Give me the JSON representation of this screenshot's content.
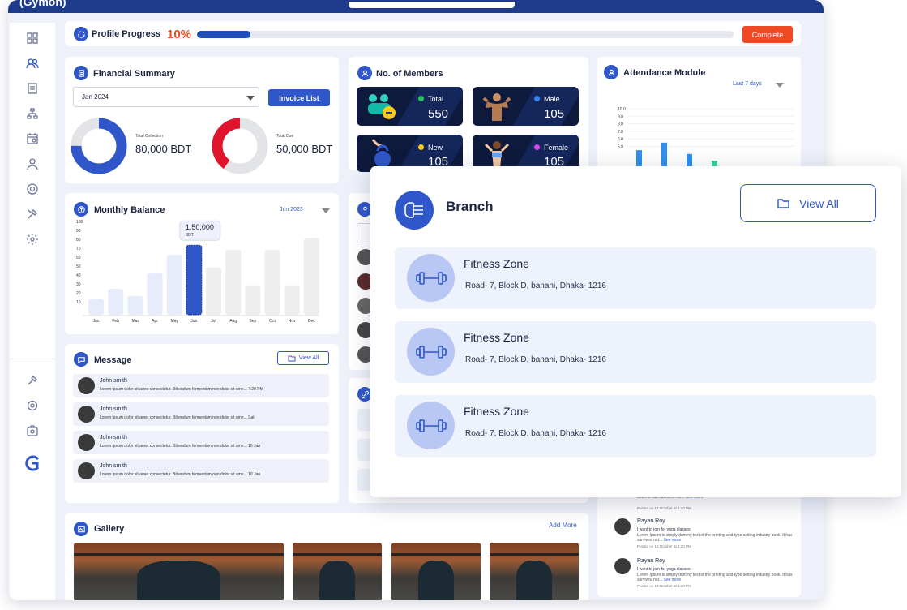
{
  "app": {
    "logo_text": "(Gymon)"
  },
  "profile_progress": {
    "title": "Profile Progress",
    "percent_text": "10%",
    "percent": 0.1,
    "button": "Complete"
  },
  "financial": {
    "title": "Financial Summary",
    "month": "Jan 2024",
    "invoice_button": "Invoice List",
    "collection_label": "Total Collection",
    "collection_value": "80,000 BDT",
    "due_label": "Total Due",
    "due_value": "50,000 BDT",
    "collection_fraction": 0.75,
    "due_fraction": 0.4,
    "colors": {
      "collection": "#2f57c9",
      "due": "#e0142c",
      "track": "#e3e4e8"
    }
  },
  "members": {
    "title": "No. of Members",
    "tiles": [
      {
        "label": "Total",
        "value": "550",
        "dot": "#22c55e"
      },
      {
        "label": "Male",
        "value": "105",
        "dot": "#3b82f6"
      },
      {
        "label": "New",
        "value": "105",
        "dot": "#facc15"
      },
      {
        "label": "Female",
        "value": "105",
        "dot": "#d946ef"
      }
    ]
  },
  "attendance": {
    "title": "Attendance Module",
    "range": "Last 7 days",
    "chart_data": {
      "type": "bar",
      "ylim": [
        0,
        10.0
      ],
      "yticks": [
        "10.0",
        "9.0",
        "8.0",
        "7.0",
        "6.0",
        "5.0"
      ],
      "values": [
        4.5,
        5.5,
        4.0,
        3.1
      ],
      "colors": [
        "#2f8fef",
        "#2f8fef",
        "#2f8fef",
        "#34d399"
      ]
    }
  },
  "monthly_balance": {
    "title": "Monthly Balance",
    "range": "Jun 2023",
    "tooltip_value": "1,50,000",
    "tooltip_unit": "BDT",
    "chart_data": {
      "type": "bar",
      "categories": [
        "Jan",
        "Feb",
        "Mar",
        "Apr",
        "May",
        "Jun",
        "Jul",
        "Aug",
        "Sep",
        "Oct",
        "Nov",
        "Dec"
      ],
      "values": [
        18,
        29,
        21,
        47,
        67,
        78,
        53,
        73,
        33,
        73,
        33,
        86
      ],
      "ylim": [
        0,
        100
      ],
      "yticks": [
        "100",
        "90",
        "80",
        "70",
        "60",
        "50",
        "40",
        "30",
        "20",
        "10"
      ],
      "highlight": "Jun"
    }
  },
  "message": {
    "title": "Message",
    "view_all": "View All",
    "items": [
      {
        "name": "John smith",
        "text": "Lorem ipsum dolor sit amet consectetur. Bibendum fermentum non dolor sit ame... 4:20 PM"
      },
      {
        "name": "John smith",
        "text": "Lorem ipsum dolor sit amet consectetur. Bibendum fermentum non dolor sit ame... Sat"
      },
      {
        "name": "John smith",
        "text": "Lorem ipsum dolor sit amet consectetur. Bibendum fermentum non dolor sit ame... 15 Jan"
      },
      {
        "name": "John smith",
        "text": "Lorem ipsum dolor sit amet consectetur. Bibendum fermentum non dolor sit ame... 10 Jan"
      }
    ]
  },
  "gallery": {
    "title": "Gallery",
    "add_more": "Add More"
  },
  "comments": {
    "items": [
      {
        "name": "Rayan Roy",
        "title": "I want to join for yoga classes",
        "body": "Lorem Ipsum is simply dummy text of the printing and type setting industry book. It has survived not...",
        "see": "See more",
        "posted": "Posted on 19 October at 4:20 PM"
      },
      {
        "name": "Rayan Roy",
        "title": "I want to join for yoga classes",
        "body": "Lorem Ipsum is simply dummy text of the printing and type setting industry book. It has survived not...",
        "see": "See more",
        "posted": "Posted on 19 October at 4:20 PM"
      }
    ],
    "partial": {
      "body": "book. It has survived not...",
      "see": "See more",
      "posted": "Posted on 19 October at 4:20 PM"
    }
  },
  "branch": {
    "title": "Branch",
    "view_all": "View All",
    "items": [
      {
        "name": "Fitness Zone",
        "address": "Road- 7, Block D, banani, Dhaka- 1216"
      },
      {
        "name": "Fitness Zone",
        "address": "Road- 7, Block D, banani, Dhaka- 1216"
      },
      {
        "name": "Fitness Zone",
        "address": "Road- 7, Block D, banani, Dhaka- 1216"
      }
    ]
  }
}
